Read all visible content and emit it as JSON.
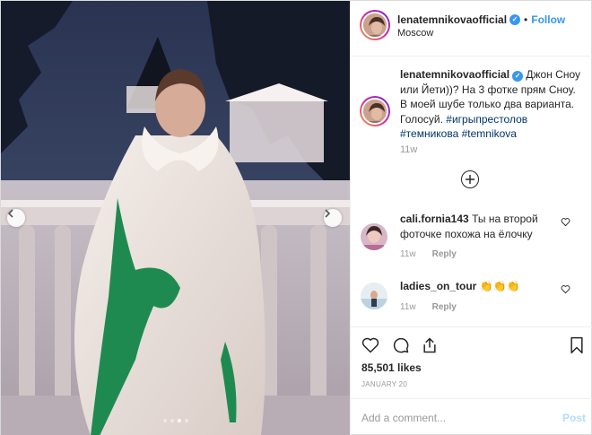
{
  "post": {
    "username": "lenatemnikovaofficial",
    "verified": true,
    "follow_label": "Follow",
    "location": "Moscow",
    "bullet": "•",
    "photo_alt": "",
    "carousel_active_index": 2,
    "carousel_count": 4
  },
  "caption": {
    "username": "lenatemnikovaofficial",
    "text": "Джон Сноу или Йети))? На 3 фотке прям Сноу. В моей шубе только два варианта. Голосуй.",
    "hashtags": [
      "#игрыпрестолов",
      "#темникова",
      "#temnikova"
    ],
    "time": "11w"
  },
  "comments": [
    {
      "username": "cali.fornia143",
      "text": "Ты на второй фоточке похожа на ёлочку",
      "time": "11w",
      "reply_label": "Reply"
    },
    {
      "username": "ladies_on_tour",
      "text": "👏👏👏",
      "time": "11w",
      "reply_label": "Reply"
    }
  ],
  "actions": {
    "likes": "85,501 likes",
    "date": "JANUARY 20"
  },
  "comment_box": {
    "placeholder": "Add a comment...",
    "post_label": "Post"
  },
  "colors": {
    "accent": "#3897f0",
    "hashtag": "#003569",
    "post_disabled": "#b3dbff",
    "muted": "#999999"
  }
}
